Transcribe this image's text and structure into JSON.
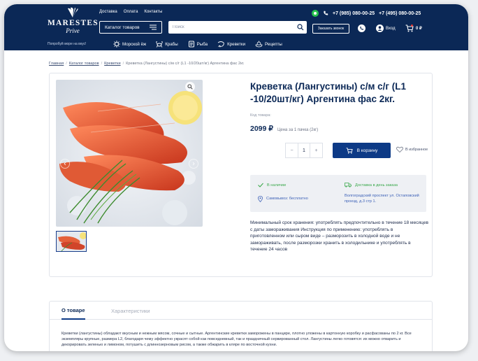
{
  "header": {
    "logo": {
      "name": "MARESTES",
      "sub": "Prive"
    },
    "tagline": "Попробуй море на вкус!",
    "top_nav": [
      "Доставка",
      "Оплата",
      "Контакты"
    ],
    "phones": [
      "+7 (985) 080-00-25",
      "+7 (495) 080-00-25"
    ],
    "catalog_button": "Каталог товаров",
    "search_placeholder": "Поиск",
    "callback_button": "Заказать звонок",
    "login": "Вход",
    "cart_total": "0 ₽",
    "categories": [
      {
        "label": "Морской ёж",
        "icon": "sea-urchin-icon"
      },
      {
        "label": "Крабы",
        "icon": "crab-icon"
      },
      {
        "label": "Рыба",
        "icon": "fish-icon"
      },
      {
        "label": "Креветки",
        "icon": "shrimp-icon"
      },
      {
        "label": "Рецепты",
        "icon": "recipe-icon"
      }
    ]
  },
  "breadcrumb": {
    "items": [
      "Главная",
      "Каталог товаров",
      "Креветки"
    ],
    "current": "Креветка (Лангустины) с/м с/г (L1 -10/20шт/кг) Аргентина фас 2кг."
  },
  "product": {
    "title": "Креветка (Лангустины) с/м с/г (L1 -10/20шт/кг) Аргентина фас 2кг.",
    "code_label": "Код товара:",
    "price": "2099 ₽",
    "price_note": "Цена за 1 пачка (2кг)",
    "quantity": "1",
    "qty_minus": "−",
    "qty_plus": "+",
    "add_to_cart": "В корзину",
    "favorite": "В избранное",
    "availability": "В наличии",
    "pickup": "Самовывоз: бесплатно",
    "delivery": "Доставка в день заказа",
    "address": "Волгоградский проспект ул. Остаповский проезд, д.3 стр 1.",
    "description": "Минимальный срок хранения: употреблять предпочтительно в течение 18 месяцев с даты замораживания Инструкция по применению: употреблять в приготовленном или сыром виде – разморозить в холодной воде и не замораживать, после разморозки хранить в холодильнике и употреблять в течение 24 часов"
  },
  "tabs": {
    "items": [
      "О товаре",
      "Характеристики"
    ],
    "active": "О товаре",
    "about_text": "Креветки (лангустины) обладают вкусным и нежным мясом, сочные и сытные. Аргентинские креветки заморожены в панцире, плотно уложены в картонную коробку и расфасованы по 2 кг. Все экземпляры крупные, размера L2, благодаря чему эффектно украсят собой как повседневный, так и праздничный сервированный стол. Лангустины легко готовятся: их можно отварить и декорировать зеленью и лимоном, потушить с длиннозерновым рисом, а также обжарить в кляре по восточной кухни."
  },
  "colors": {
    "header_bg": "#0b2856",
    "accent": "#0d3a86",
    "in_stock": "#3aa84b",
    "link": "#3f63b8",
    "whatsapp": "#27c24c"
  }
}
